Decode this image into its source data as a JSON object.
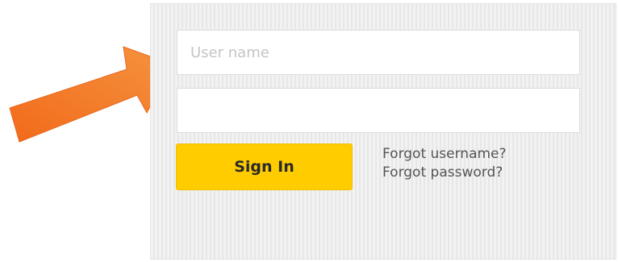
{
  "login": {
    "username_placeholder": "User name",
    "username_value": "",
    "password_placeholder": "",
    "password_value": "",
    "signin_label": "Sign In",
    "forgot_username_label": "Forgot username?",
    "forgot_password_label": "Forgot password?"
  },
  "annotation": {
    "icon": "arrow-pointer-icon",
    "color": "#f07a28"
  },
  "colors": {
    "button": "#ffcc00",
    "panel": "#efefef",
    "link": "#555555"
  }
}
